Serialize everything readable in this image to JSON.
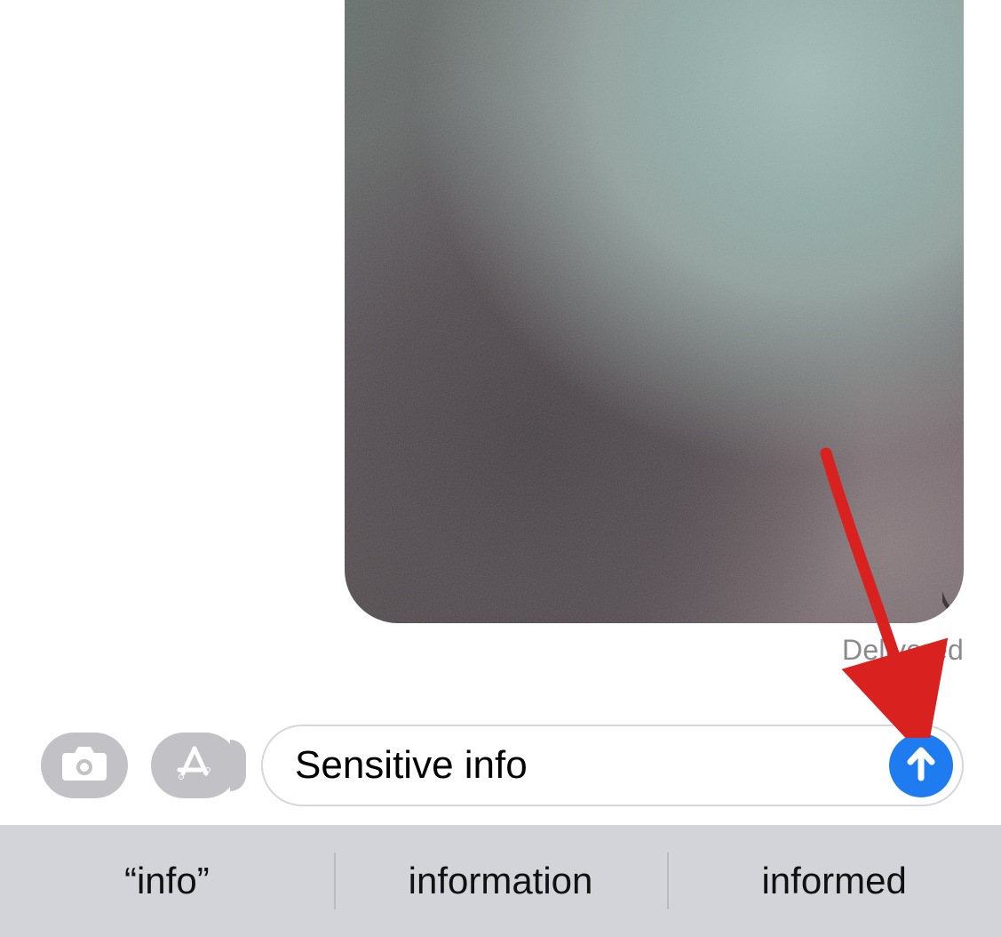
{
  "message": {
    "delivery_status": "Delivered"
  },
  "compose": {
    "input_value": "Sensitive info"
  },
  "keyboard": {
    "suggestions": [
      "“info”",
      "information",
      "informed"
    ]
  },
  "colors": {
    "send_button": "#1f7cf0",
    "accessory_button": "#c1c1c6",
    "suggestion_bar": "#d2d4d9",
    "annotation": "#d9221f"
  }
}
